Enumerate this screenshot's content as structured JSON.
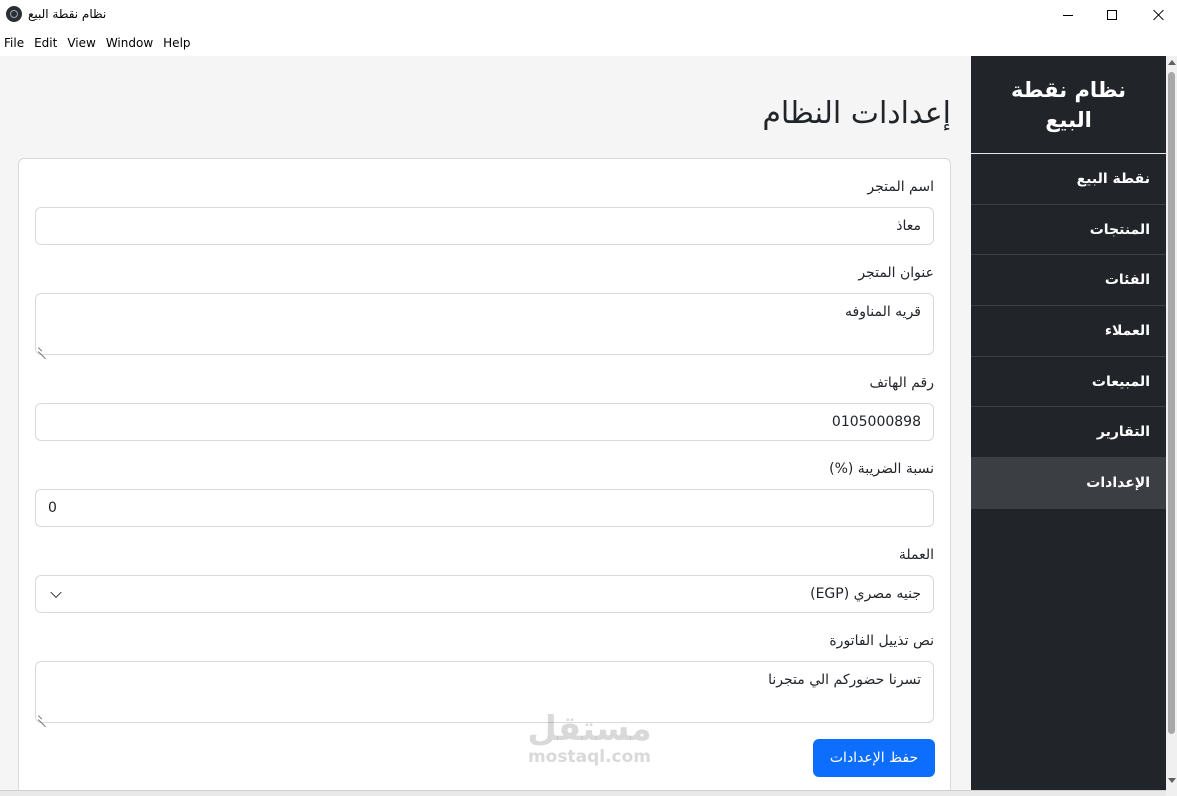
{
  "window": {
    "title": "نظام نقطة البيع"
  },
  "menu": {
    "items": [
      "File",
      "Edit",
      "View",
      "Window",
      "Help"
    ]
  },
  "page": {
    "title": "إعدادات النظام"
  },
  "form": {
    "store_name": {
      "label": "اسم المتجر",
      "value": "معاذ"
    },
    "store_address": {
      "label": "عنوان المتجر",
      "value": "قريه المناوفه"
    },
    "phone": {
      "label": "رقم الهاتف",
      "value": "0105000898"
    },
    "tax_rate": {
      "label": "نسبة الضريبة (%)",
      "value": "0"
    },
    "currency": {
      "label": "العملة",
      "value": "جنيه مصري (EGP)"
    },
    "invoice_footer": {
      "label": "نص تذييل الفاتورة",
      "value": "تسرنا حضوركم الي متجرنا"
    },
    "save_label": "حفظ الإعدادات"
  },
  "sidebar": {
    "brand": "نظام نقطة البيع",
    "items": [
      {
        "label": "نقطة البيع",
        "active": false
      },
      {
        "label": "المنتجات",
        "active": false
      },
      {
        "label": "الفئات",
        "active": false
      },
      {
        "label": "العملاء",
        "active": false
      },
      {
        "label": "المبيعات",
        "active": false
      },
      {
        "label": "التقارير",
        "active": false
      },
      {
        "label": "الإعدادات",
        "active": true
      }
    ]
  },
  "watermark": {
    "arabic": "مستقل",
    "latin": "mostaql.com"
  },
  "colors": {
    "sidebar_bg": "#212529",
    "sidebar_active": "#3b3e43",
    "primary": "#0d6efd",
    "content_bg": "#f5f5f5"
  }
}
